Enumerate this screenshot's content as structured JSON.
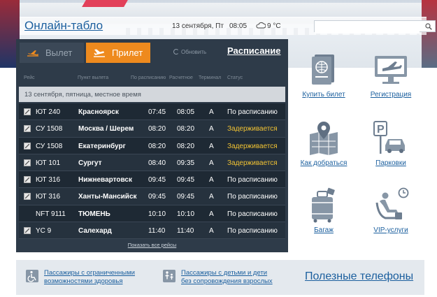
{
  "header": {
    "title": "Онлайн-табло",
    "date": "13 сентября, Пт",
    "time": "08:05",
    "temperature": "9 °C",
    "weather_icon": "cloud-icon",
    "search_placeholder": ""
  },
  "board": {
    "tabs": [
      {
        "label": "Вылет",
        "icon": "departure-plane-icon",
        "active": false
      },
      {
        "label": "Прилет",
        "icon": "arrival-plane-icon",
        "active": true
      }
    ],
    "refresh_label": "Обновить",
    "schedule_label": "Расписание",
    "columns": [
      "Рейс",
      "Пункт вылета",
      "По расписанию",
      "Расчетное",
      "Терминал",
      "Статус"
    ],
    "date_band": "13 сентября, пятница, местное время",
    "flights": [
      {
        "flight": "ЮТ 240",
        "city": "Красноярск",
        "scheduled": "07:45",
        "estimated": "08:05",
        "terminal": "A",
        "status": "По расписанию",
        "delayed": false,
        "logo": true
      },
      {
        "flight": "СУ 1508",
        "city": "Москва / Шерем",
        "scheduled": "08:20",
        "estimated": "08:20",
        "terminal": "A",
        "status": "Задерживается",
        "delayed": true,
        "logo": true
      },
      {
        "flight": "СУ 1508",
        "city": "Екатеринбург",
        "scheduled": "08:20",
        "estimated": "08:20",
        "terminal": "A",
        "status": "Задерживается",
        "delayed": true,
        "logo": true
      },
      {
        "flight": "ЮТ 101",
        "city": "Сургут",
        "scheduled": "08:40",
        "estimated": "09:35",
        "terminal": "A",
        "status": "Задерживается",
        "delayed": true,
        "logo": true
      },
      {
        "flight": "ЮТ 316",
        "city": "Нижневартовск",
        "scheduled": "09:45",
        "estimated": "09:45",
        "terminal": "A",
        "status": "По расписанию",
        "delayed": false,
        "logo": true
      },
      {
        "flight": "ЮТ 316",
        "city": "Ханты-Мансийск",
        "scheduled": "09:45",
        "estimated": "09:45",
        "terminal": "A",
        "status": "По расписанию",
        "delayed": false,
        "logo": true
      },
      {
        "flight": "NFT 9111",
        "city": "ТЮМЕНЬ",
        "scheduled": "10:10",
        "estimated": "10:10",
        "terminal": "A",
        "status": "По расписанию",
        "delayed": false,
        "logo": false
      },
      {
        "flight": "YC 9",
        "city": "Салехард",
        "scheduled": "11:40",
        "estimated": "11:40",
        "terminal": "A",
        "status": "По расписанию",
        "delayed": false,
        "logo": true
      }
    ],
    "show_all_label": "Показать все рейсы"
  },
  "services": [
    {
      "label": "Купить билет",
      "icon": "passport-icon"
    },
    {
      "label": "Регистрация",
      "icon": "monitor-plane-icon"
    },
    {
      "label": "Как добраться",
      "icon": "map-pin-icon"
    },
    {
      "label": "Парковки",
      "icon": "parking-car-icon"
    },
    {
      "label": "Багаж",
      "icon": "luggage-icon"
    },
    {
      "label": "VIP-услуги",
      "icon": "vip-seat-icon"
    }
  ],
  "bottom": {
    "accessibility_label": "Пассажиры с ограниченными возможностями здоровья",
    "accessibility_line1": "Пассажиры с ограниченными",
    "accessibility_line2": "возможностями здоровья",
    "children_line1": "Пассажиры с детьми и дети",
    "children_line2": "без сопровождения взрослых",
    "phones_label": "Полезные телефоны"
  },
  "colors": {
    "board_bg": "#2e3b49",
    "active_tab": "#ee8a1e",
    "delayed": "#f0c233",
    "link": "#1b5f9e",
    "icon": "#8796a6"
  }
}
